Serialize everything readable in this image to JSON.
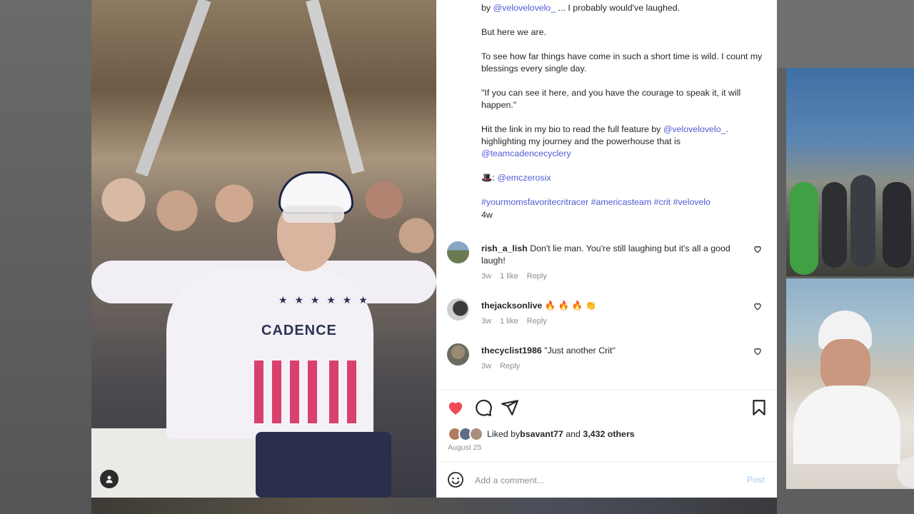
{
  "caption": {
    "line1_prefix": "by ",
    "line1_mention": "@velovelovelo_",
    "line1_suffix": " ... I probably would've laughed.",
    "p2": "But here we are.",
    "p3": "To see how far things have come in such a short time is wild. I count my blessings every single day.",
    "p4": "\"If you can see it here, and you have the courage to speak it, it will happen.\"",
    "p5_prefix": "Hit the link in my bio to read the full feature by ",
    "p5_mention1": "@velovelovelo_",
    "p5_middle": ". highlighting my journey and the powerhouse that is",
    "p5_mention2": "@teamcadencecyclery",
    "p5_suffix": ".",
    "credit_emoji": "🎩",
    "credit_sep": ": ",
    "credit_mention": "@emczerosix",
    "hashtags": [
      "#yourmomsfavoritecritracer",
      "#americasteam",
      "#crit",
      "#velovelo"
    ],
    "age": "4w"
  },
  "comments": [
    {
      "user": "rish_a_lish",
      "text": "Don't lie man. You're still laughing but it's all a good laugh!",
      "age": "3w",
      "likes": "1 like",
      "reply": "Reply"
    },
    {
      "user": "thejacksonlive",
      "text": "🔥 🔥 🔥 👏",
      "age": "3w",
      "likes": "1 like",
      "reply": "Reply"
    },
    {
      "user": "thecyclist1986",
      "text": "\"Just another Crit\"",
      "age": "3w",
      "likes": "",
      "reply": "Reply"
    }
  ],
  "likes": {
    "prefix": "Liked by ",
    "user": "bsavant77",
    "middle": " and ",
    "count": "3,432 others"
  },
  "date": "August 25",
  "composer": {
    "placeholder": "Add a comment...",
    "post_label": "Post"
  },
  "photo": {
    "jersey_text": "CADENCE",
    "stars": "★ ★ ★ ★ ★ ★"
  },
  "colors": {
    "like_red": "#ed4956",
    "link_blue": "#4f5bd5",
    "post_blue": "#a9c9f5"
  },
  "icons": [
    "heart-icon",
    "comment-icon",
    "share-icon",
    "bookmark-icon",
    "emoji-icon",
    "user-icon",
    "heart-outline-icon"
  ]
}
